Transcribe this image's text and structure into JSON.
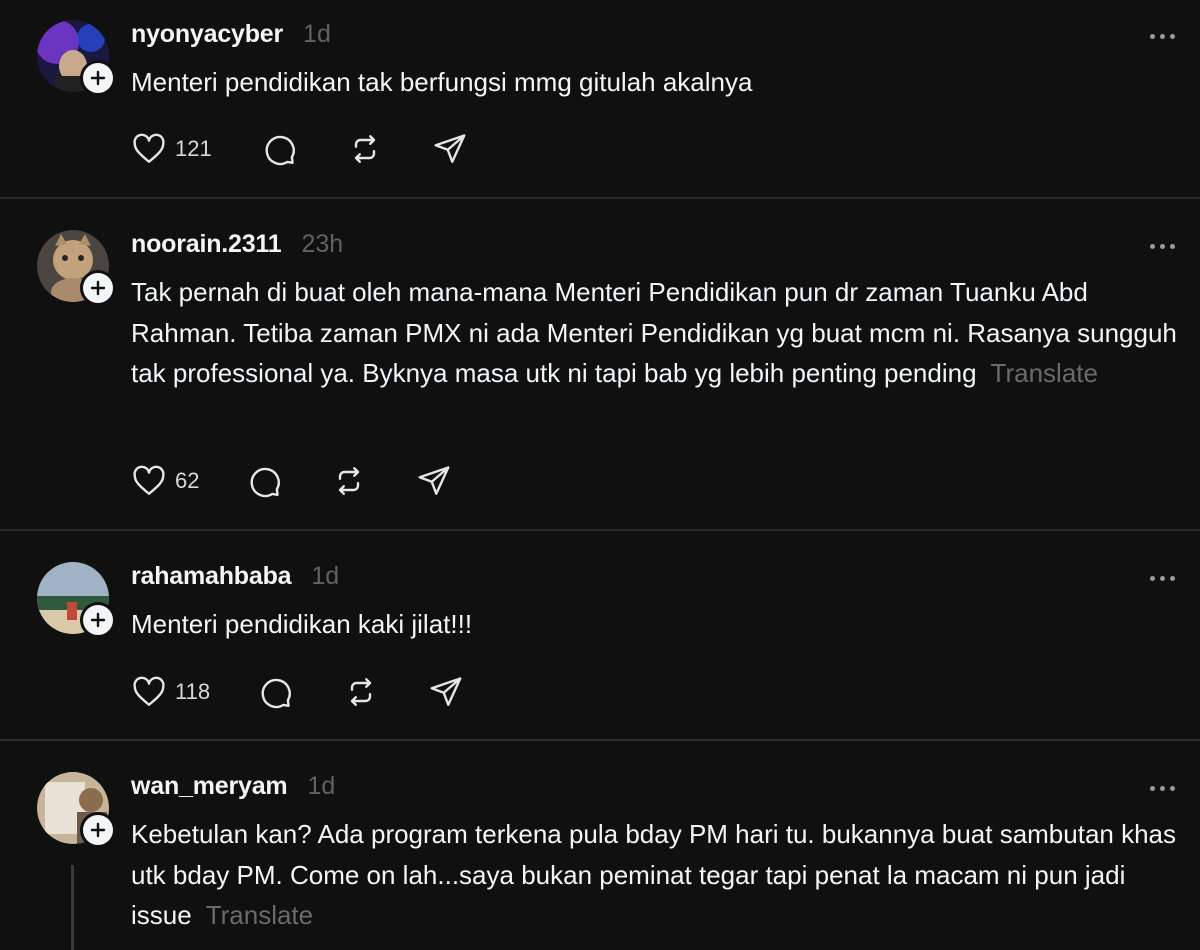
{
  "posts": [
    {
      "username": "nyonyacyber",
      "time": "1d",
      "text": "Menteri pendidikan tak berfungsi mmg gitulah akalnya",
      "translate": "",
      "likes": "121",
      "avatar_colors": [
        "#2a1f6e",
        "#7a3ad8",
        "#1a1840"
      ]
    },
    {
      "username": "noorain.2311",
      "time": "23h",
      "text": "Tak pernah di buat oleh mana-mana Menteri Pendidikan pun dr zaman Tuanku Abd Rahman. Tetiba zaman PMX ni ada Menteri Pendidikan yg buat mcm ni. Rasanya sungguh tak professional ya. Byknya masa utk ni tapi bab yg lebih penting pending",
      "translate": "Translate",
      "likes": "62",
      "avatar_colors": [
        "#6b6258",
        "#c2a27c",
        "#3d3833"
      ]
    },
    {
      "username": "rahamahbaba",
      "time": "1d",
      "text": "Menteri pendidikan kaki jilat!!!",
      "translate": "",
      "likes": "118",
      "avatar_colors": [
        "#9fb3c4",
        "#2f5a3e",
        "#d9c9a8"
      ]
    },
    {
      "username": "wan_meryam",
      "time": "1d",
      "text": "Kebetulan kan? Ada program terkena pula bday PM hari tu. bukannya buat sambutan khas utk bday PM. Come on lah...saya bukan peminat tegar tapi penat la macam ni pun jadi issue",
      "translate": "Translate",
      "likes": "",
      "avatar_colors": [
        "#c7b59a",
        "#e8e2d6",
        "#8a6d4f"
      ]
    }
  ],
  "icons": {
    "like": "heart-icon",
    "reply": "comment-icon",
    "repost": "repost-icon",
    "share": "send-icon",
    "more": "more-dots-icon",
    "follow": "plus-icon"
  }
}
